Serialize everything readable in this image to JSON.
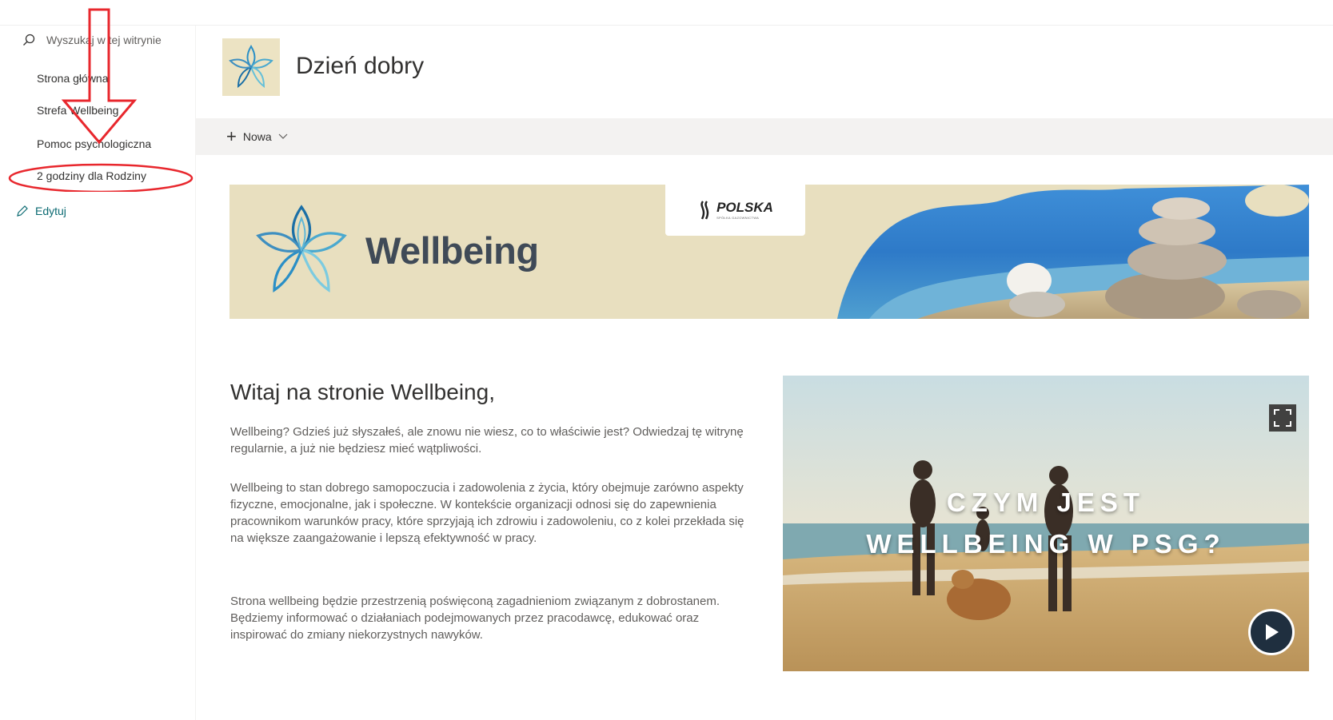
{
  "nav": {
    "search_placeholder": "Wyszukaj w tej witrynie",
    "items": [
      {
        "label": "Strona główna"
      },
      {
        "label": "Strefa Wellbeing"
      },
      {
        "label": "Pomoc psychologiczna"
      },
      {
        "label": "2 godziny dla Rodziny"
      }
    ],
    "edit_label": "Edytuj"
  },
  "header": {
    "title": "Dzień dobry"
  },
  "command_bar": {
    "new_label": "Nowa"
  },
  "banner": {
    "heading": "Wellbeing",
    "partner_logo_text": "POLSKA",
    "partner_logo_sub": "SPÓŁKA GAZOWNICTWA"
  },
  "content": {
    "welcome_title": "Witaj na stronie Wellbeing,",
    "paragraphs": [
      "Wellbeing? Gdzieś już słyszałeś, ale znowu nie wiesz, co to właściwie jest? Odwiedzaj tę witrynę regularnie, a już nie będziesz mieć wątpliwości.",
      "Wellbeing to stan dobrego samopoczucia i zadowolenia z życia, który obejmuje zarówno aspekty fizyczne, emocjonalne, jak i społeczne. W kontekście organizacji odnosi się do zapewnienia pracownikom warunków pracy, które sprzyjają ich zdrowiu i zadowoleniu, co z kolei przekłada się na większe zaangażowanie i lepszą efektywność w pracy.",
      "Strona wellbeing będzie przestrzenią poświęconą zagadnieniom związanym z dobrostanem. Będziemy informować o działaniach podejmowanych przez pracodawcę, edukować oraz inspirować do zmiany niekorzystnych nawyków."
    ]
  },
  "video": {
    "caption_line1": "CZYM JEST",
    "caption_line2": "WELLBEING W PSG?"
  },
  "colors": {
    "annotation": "#e8272d",
    "edit_link": "#0b6a72",
    "banner_bg": "#e8dfbf",
    "logo_blue": "#2a8fc6"
  }
}
